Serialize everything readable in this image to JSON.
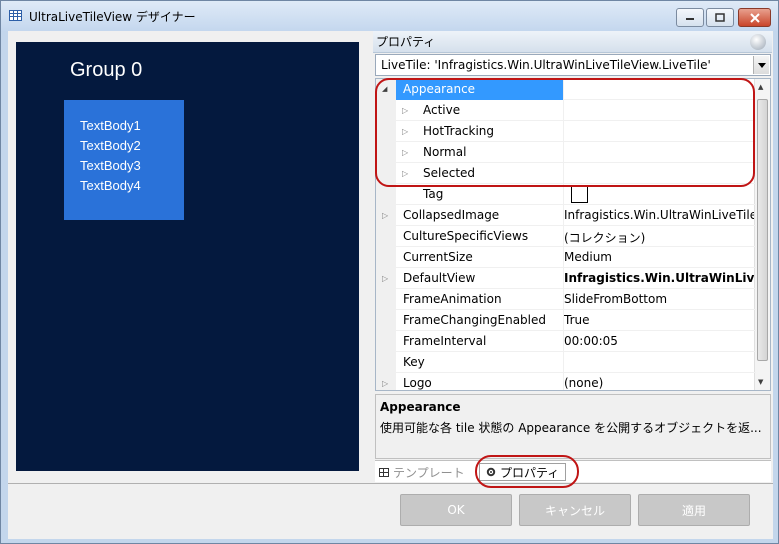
{
  "window": {
    "title": "UltraLiveTileView デザイナー",
    "controls": {
      "minimize_icon": "minimize-icon",
      "maximize_icon": "maximize-icon",
      "close_icon": "close-icon"
    }
  },
  "preview": {
    "group_label": "Group 0",
    "tile_lines": [
      "TextBody1",
      "TextBody2",
      "TextBody3",
      "TextBody4"
    ],
    "tile_color": "#2a72d9",
    "background": "#04193e"
  },
  "properties": {
    "header": "プロパティ",
    "object_selector": "LiveTile: 'Infragistics.Win.UltraWinLiveTileView.LiveTile'",
    "rows": [
      {
        "name": "Appearance",
        "value": "",
        "expander": "down",
        "selected": true,
        "indent": 0
      },
      {
        "name": "Active",
        "value": "",
        "expander": "right",
        "indent": 1
      },
      {
        "name": "HotTracking",
        "value": "",
        "expander": "right",
        "indent": 1
      },
      {
        "name": "Normal",
        "value": "",
        "expander": "right",
        "indent": 1
      },
      {
        "name": "Selected",
        "value": "",
        "expander": "right",
        "indent": 1
      },
      {
        "name": "Tag",
        "value": "",
        "expander": "",
        "indent": 1,
        "swatch": true
      },
      {
        "name": "CollapsedImage",
        "value": "Infragistics.Win.UltraWinLiveTile",
        "expander": "right",
        "indent": 0
      },
      {
        "name": "CultureSpecificViews",
        "value": "(コレクション)",
        "expander": "",
        "indent": 0
      },
      {
        "name": "CurrentSize",
        "value": "Medium",
        "expander": "",
        "indent": 0
      },
      {
        "name": "DefaultView",
        "value": "Infragistics.Win.UltraWinLive",
        "expander": "right",
        "indent": 0,
        "bold": true
      },
      {
        "name": "FrameAnimation",
        "value": "SlideFromBottom",
        "expander": "",
        "indent": 0
      },
      {
        "name": "FrameChangingEnabled",
        "value": "True",
        "expander": "",
        "indent": 0
      },
      {
        "name": "FrameInterval",
        "value": "00:00:05",
        "expander": "",
        "indent": 0
      },
      {
        "name": "Key",
        "value": "",
        "expander": "",
        "indent": 0
      },
      {
        "name": "Logo",
        "value": "(none)",
        "expander": "right",
        "indent": 0
      }
    ],
    "description": {
      "title": "Appearance",
      "body": "使用可能な各 tile 状態の Appearance を公開するオブジェクトを返..."
    },
    "tabs": [
      {
        "label": "テンプレート",
        "active": false
      },
      {
        "label": "プロパティ",
        "active": true
      }
    ]
  },
  "buttons": {
    "ok": "OK",
    "cancel": "キャンセル",
    "apply": "適用"
  },
  "colors": {
    "highlight_ring": "#c01515",
    "selection": "#3399ff"
  }
}
